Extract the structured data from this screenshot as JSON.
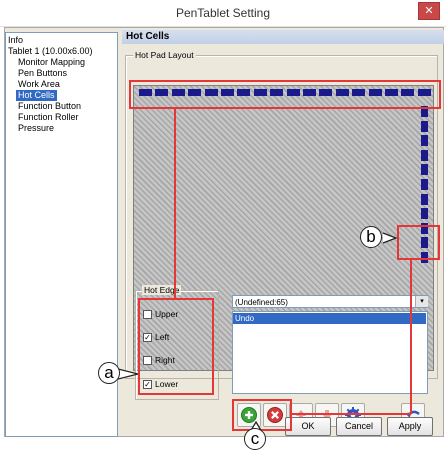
{
  "window": {
    "title": "PenTablet Setting",
    "close_glyph": "✕"
  },
  "tree": {
    "items": [
      {
        "label": "Info"
      },
      {
        "label": "Tablet  1 (10.00x6.00)"
      },
      {
        "label": "Monitor Mapping"
      },
      {
        "label": "Pen Buttons"
      },
      {
        "label": "Work Area"
      },
      {
        "label": "Hot Cells",
        "selected": true
      },
      {
        "label": "Function Button"
      },
      {
        "label": "Function Roller"
      },
      {
        "label": "Pressure"
      }
    ]
  },
  "panel": {
    "header": "Hot Cells",
    "hotpad_legend": "Hot Pad Layout",
    "hot_edge_legend": "Hot Edge",
    "edges": [
      {
        "label": "Upper",
        "checked": false
      },
      {
        "label": "Left",
        "checked": true
      },
      {
        "label": "Right",
        "checked": false
      },
      {
        "label": "Lower",
        "checked": true
      }
    ],
    "dropdown_value": "(Undefined:65)",
    "dropdown_arrow": "▾",
    "list_selected": "Undo"
  },
  "toolbar": {
    "add_icon": "add-icon",
    "remove_icon": "remove-icon",
    "move_up_icon": "move-up-icon",
    "move_down_icon": "move-down-icon",
    "settings_icon": "gear-icon",
    "undo_icon": "undo-icon",
    "add_color": "#3aa43a",
    "remove_color": "#d43a3a"
  },
  "buttons": {
    "ok": "OK",
    "cancel": "Cancel",
    "apply": "Apply"
  },
  "callouts": {
    "a": "a",
    "b": "b",
    "c": "c"
  },
  "colors": {
    "cell": "#1a1a8c",
    "highlight": "#e53737",
    "selection": "#316ac5"
  }
}
